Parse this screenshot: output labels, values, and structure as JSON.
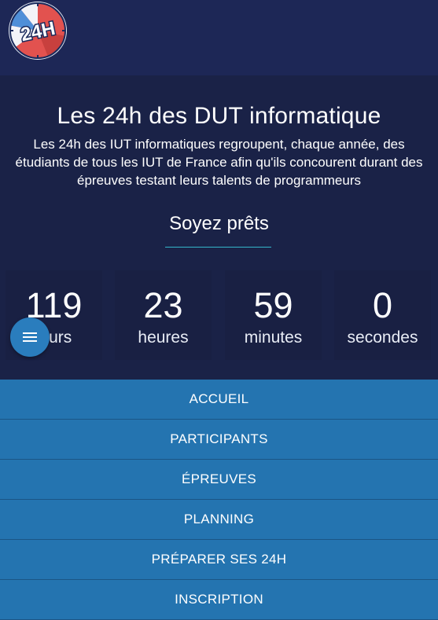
{
  "header": {
    "logo_text": "24H"
  },
  "hero": {
    "title": "Les 24h des DUT informatique",
    "description": "Les 24h des IUT informatiques regroupent, chaque année, des étudiants de tous les IUT de France afin qu'ils concourent durant des épreuves testant leurs talents de programmeurs",
    "tagline": "Soyez prêts"
  },
  "countdown": {
    "days": {
      "value": "119",
      "unit": "jours"
    },
    "hours": {
      "value": "23",
      "unit": "heures"
    },
    "minutes": {
      "value": "59",
      "unit": "minutes"
    },
    "seconds": {
      "value": "0",
      "unit": "secondes"
    }
  },
  "nav": {
    "items": [
      {
        "label": "ACCUEIL"
      },
      {
        "label": "PARTICIPANTS"
      },
      {
        "label": "ÉPREUVES"
      },
      {
        "label": "PLANNING"
      },
      {
        "label": "PRÉPARER SES 24H"
      },
      {
        "label": "INSCRIPTION"
      }
    ]
  },
  "menu_button": {
    "icon": "menu-icon"
  },
  "colors": {
    "header_bg": "#1d2756",
    "hero_bg": "#1a2247",
    "counter_bg": "#192043",
    "accent_line": "#34b6c9",
    "nav_bg": "#2474b0",
    "fab_bg": "#2a7dbd"
  }
}
